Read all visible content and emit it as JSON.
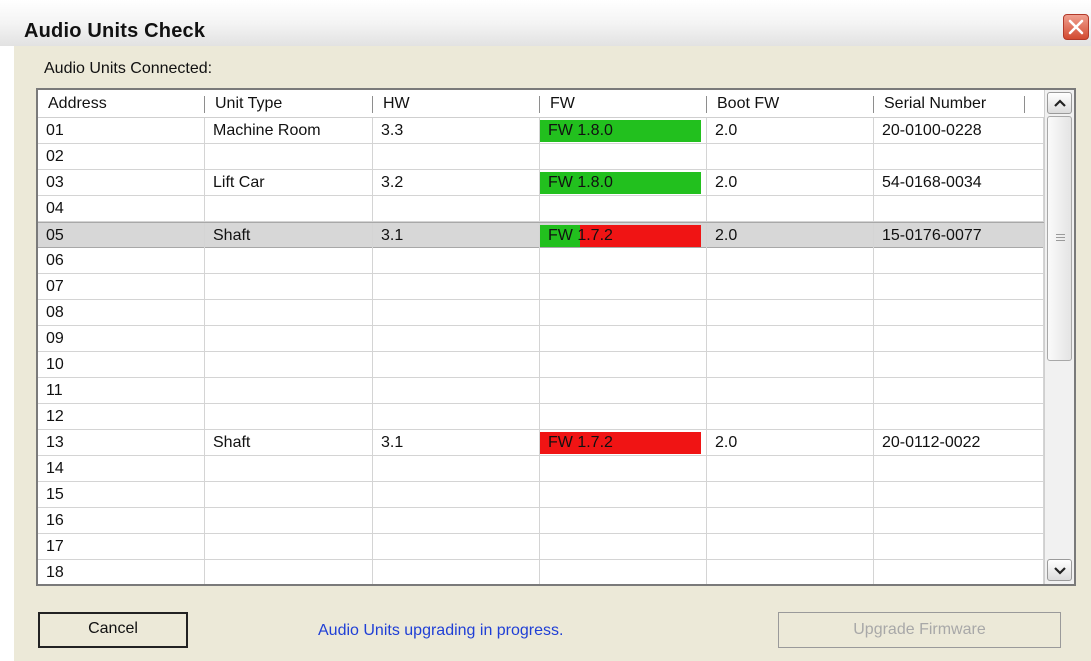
{
  "window": {
    "title": "Audio Units Check",
    "close_icon": "close-icon"
  },
  "units_label": "Audio Units Connected:",
  "table": {
    "columns": [
      "Address",
      "Unit Type",
      "HW",
      "FW",
      "Boot FW",
      "Serial Number"
    ],
    "rows": [
      {
        "address": "01",
        "unit_type": "Machine Room",
        "hw": "3.3",
        "fw": "FW 1.8.0",
        "fw_status": "ok",
        "boot_fw": "2.0",
        "serial": "20-0100-0228"
      },
      {
        "address": "02",
        "unit_type": "",
        "hw": "",
        "fw": "",
        "fw_status": "",
        "boot_fw": "",
        "serial": ""
      },
      {
        "address": "03",
        "unit_type": "Lift Car",
        "hw": "3.2",
        "fw": "FW 1.8.0",
        "fw_status": "ok",
        "boot_fw": "2.0",
        "serial": "54-0168-0034"
      },
      {
        "address": "04",
        "unit_type": "",
        "hw": "",
        "fw": "",
        "fw_status": "",
        "boot_fw": "",
        "serial": ""
      },
      {
        "address": "05",
        "unit_type": "Shaft",
        "hw": "3.1",
        "fw": "FW 1.7.2",
        "fw_status": "upgrading",
        "fw_progress": 0.25,
        "boot_fw": "2.0",
        "serial": "15-0176-0077",
        "selected": true
      },
      {
        "address": "06",
        "unit_type": "",
        "hw": "",
        "fw": "",
        "fw_status": "",
        "boot_fw": "",
        "serial": ""
      },
      {
        "address": "07",
        "unit_type": "",
        "hw": "",
        "fw": "",
        "fw_status": "",
        "boot_fw": "",
        "serial": ""
      },
      {
        "address": "08",
        "unit_type": "",
        "hw": "",
        "fw": "",
        "fw_status": "",
        "boot_fw": "",
        "serial": ""
      },
      {
        "address": "09",
        "unit_type": "",
        "hw": "",
        "fw": "",
        "fw_status": "",
        "boot_fw": "",
        "serial": ""
      },
      {
        "address": "10",
        "unit_type": "",
        "hw": "",
        "fw": "",
        "fw_status": "",
        "boot_fw": "",
        "serial": ""
      },
      {
        "address": "11",
        "unit_type": "",
        "hw": "",
        "fw": "",
        "fw_status": "",
        "boot_fw": "",
        "serial": ""
      },
      {
        "address": "12",
        "unit_type": "",
        "hw": "",
        "fw": "",
        "fw_status": "",
        "boot_fw": "",
        "serial": ""
      },
      {
        "address": "13",
        "unit_type": "Shaft",
        "hw": "3.1",
        "fw": "FW 1.7.2",
        "fw_status": "outdated",
        "boot_fw": "2.0",
        "serial": "20-0112-0022"
      },
      {
        "address": "14",
        "unit_type": "",
        "hw": "",
        "fw": "",
        "fw_status": "",
        "boot_fw": "",
        "serial": ""
      },
      {
        "address": "15",
        "unit_type": "",
        "hw": "",
        "fw": "",
        "fw_status": "",
        "boot_fw": "",
        "serial": ""
      },
      {
        "address": "16",
        "unit_type": "",
        "hw": "",
        "fw": "",
        "fw_status": "",
        "boot_fw": "",
        "serial": ""
      },
      {
        "address": "17",
        "unit_type": "",
        "hw": "",
        "fw": "",
        "fw_status": "",
        "boot_fw": "",
        "serial": ""
      },
      {
        "address": "18",
        "unit_type": "",
        "hw": "",
        "fw": "",
        "fw_status": "",
        "boot_fw": "",
        "serial": ""
      }
    ]
  },
  "scrollbar": {
    "up_icon": "chevron-up-icon",
    "down_icon": "chevron-down-icon",
    "grip_icon": "grip-icon"
  },
  "buttons": {
    "cancel": "Cancel",
    "upgrade": "Upgrade Firmware",
    "upgrade_enabled": false
  },
  "status_text": "Audio Units upgrading in progress.",
  "colors": {
    "ok": "#22c01e",
    "outdated": "#f01414",
    "status_text": "#1f3fd6",
    "selected_row": "#d7d7d7"
  }
}
